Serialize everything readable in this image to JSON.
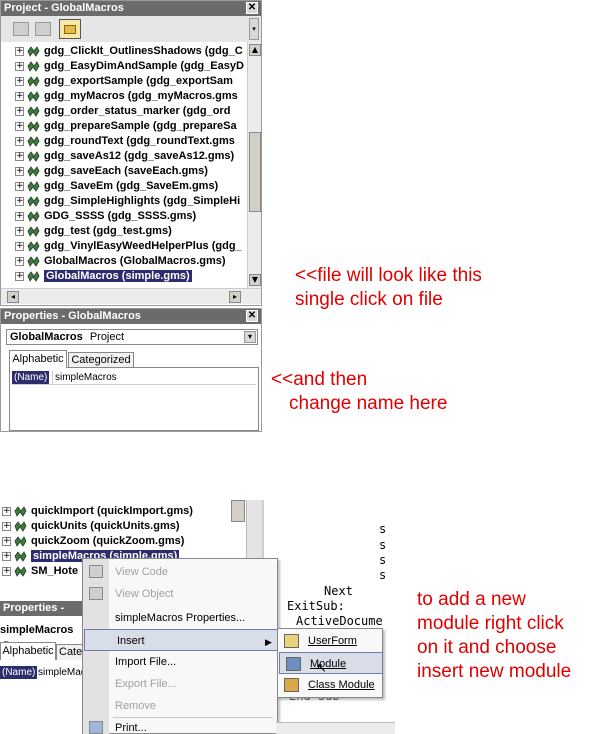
{
  "project_panel": {
    "title": "Project - GlobalMacros",
    "items": [
      {
        "label": "gdg_ClickIt_OutlinesShadows (gdg_C"
      },
      {
        "label": "gdg_EasyDimAndSample (gdg_EasyD"
      },
      {
        "label": "gdg_exportSample (gdg_exportSam"
      },
      {
        "label": "gdg_myMacros (gdg_myMacros.gms"
      },
      {
        "label": "gdg_order_status_marker (gdg_ord"
      },
      {
        "label": "gdg_prepareSample (gdg_prepareSa"
      },
      {
        "label": "gdg_roundText (gdg_roundText.gms"
      },
      {
        "label": "gdg_saveAs12 (gdg_saveAs12.gms)"
      },
      {
        "label": "gdg_saveEach (saveEach.gms)"
      },
      {
        "label": "gdg_SaveEm (gdg_SaveEm.gms)"
      },
      {
        "label": "gdg_SimpleHighlights (gdg_SimpleHi"
      },
      {
        "label": "GDG_SSSS (gdg_SSSS.gms)"
      },
      {
        "label": "gdg_test (gdg_test.gms)"
      },
      {
        "label": "gdg_VinylEasyWeedHelperPlus (gdg_"
      },
      {
        "label": "GlobalMacros (GlobalMacros.gms)"
      },
      {
        "label": "GlobalMacros (simple.gms)"
      }
    ]
  },
  "properties_panel": {
    "title": "Properties - GlobalMacros",
    "object_name": "GlobalMacros",
    "object_type": "Project",
    "tab_alphabetic": "Alphabetic",
    "tab_categorized": "Categorized",
    "prop_name_label": "(Name)",
    "prop_name_value": "simpleMacros"
  },
  "annotations": {
    "a1_line1": "<<file will look like this",
    "a1_line2": "single click on file",
    "a2_line1": "<<and then",
    "a2_line2": "change name here",
    "a3_line1": "to add a new",
    "a3_line2": "module right click",
    "a3_line3": "on it and choose",
    "a3_line4": "insert new module"
  },
  "bottom_tree": {
    "items": [
      {
        "label": "quickImport (quickImport.gms)"
      },
      {
        "label": "quickUnits (quickUnits.gms)"
      },
      {
        "label": "quickZoom (quickZoom.gms)"
      },
      {
        "label": "simpleMacros (simple.gms)"
      },
      {
        "label": "SM_Hote"
      }
    ],
    "props_title": "Properties - simp",
    "props_object": "simpleMacros",
    "props_object_type": "Pr",
    "tab_alphabetic": "Alphabetic",
    "tab_categorized": "Cate",
    "prop_name_label": "(Name)",
    "prop_name_value": "simpleMac"
  },
  "context_menu": {
    "items": [
      {
        "label": "View Code",
        "disabled": true
      },
      {
        "label": "View Object",
        "disabled": true
      },
      {
        "label": "simpleMacros Properties...",
        "disabled": false
      },
      {
        "label": "Insert",
        "disabled": false
      },
      {
        "label": "Import File...",
        "disabled": false
      },
      {
        "label": "Export File...",
        "disabled": true
      },
      {
        "label": "Remove",
        "disabled": true
      },
      {
        "label": "Print...",
        "disabled": false
      }
    ],
    "submenu": [
      {
        "label": "UserForm"
      },
      {
        "label": "Module"
      },
      {
        "label": "Class Module"
      }
    ]
  },
  "code": {
    "line1": "Next",
    "line2": "ExitSub:",
    "line3": "ActiveDocume",
    "line4": "End Sub",
    "side_chars": [
      "s",
      "s",
      "s",
      "s"
    ]
  }
}
